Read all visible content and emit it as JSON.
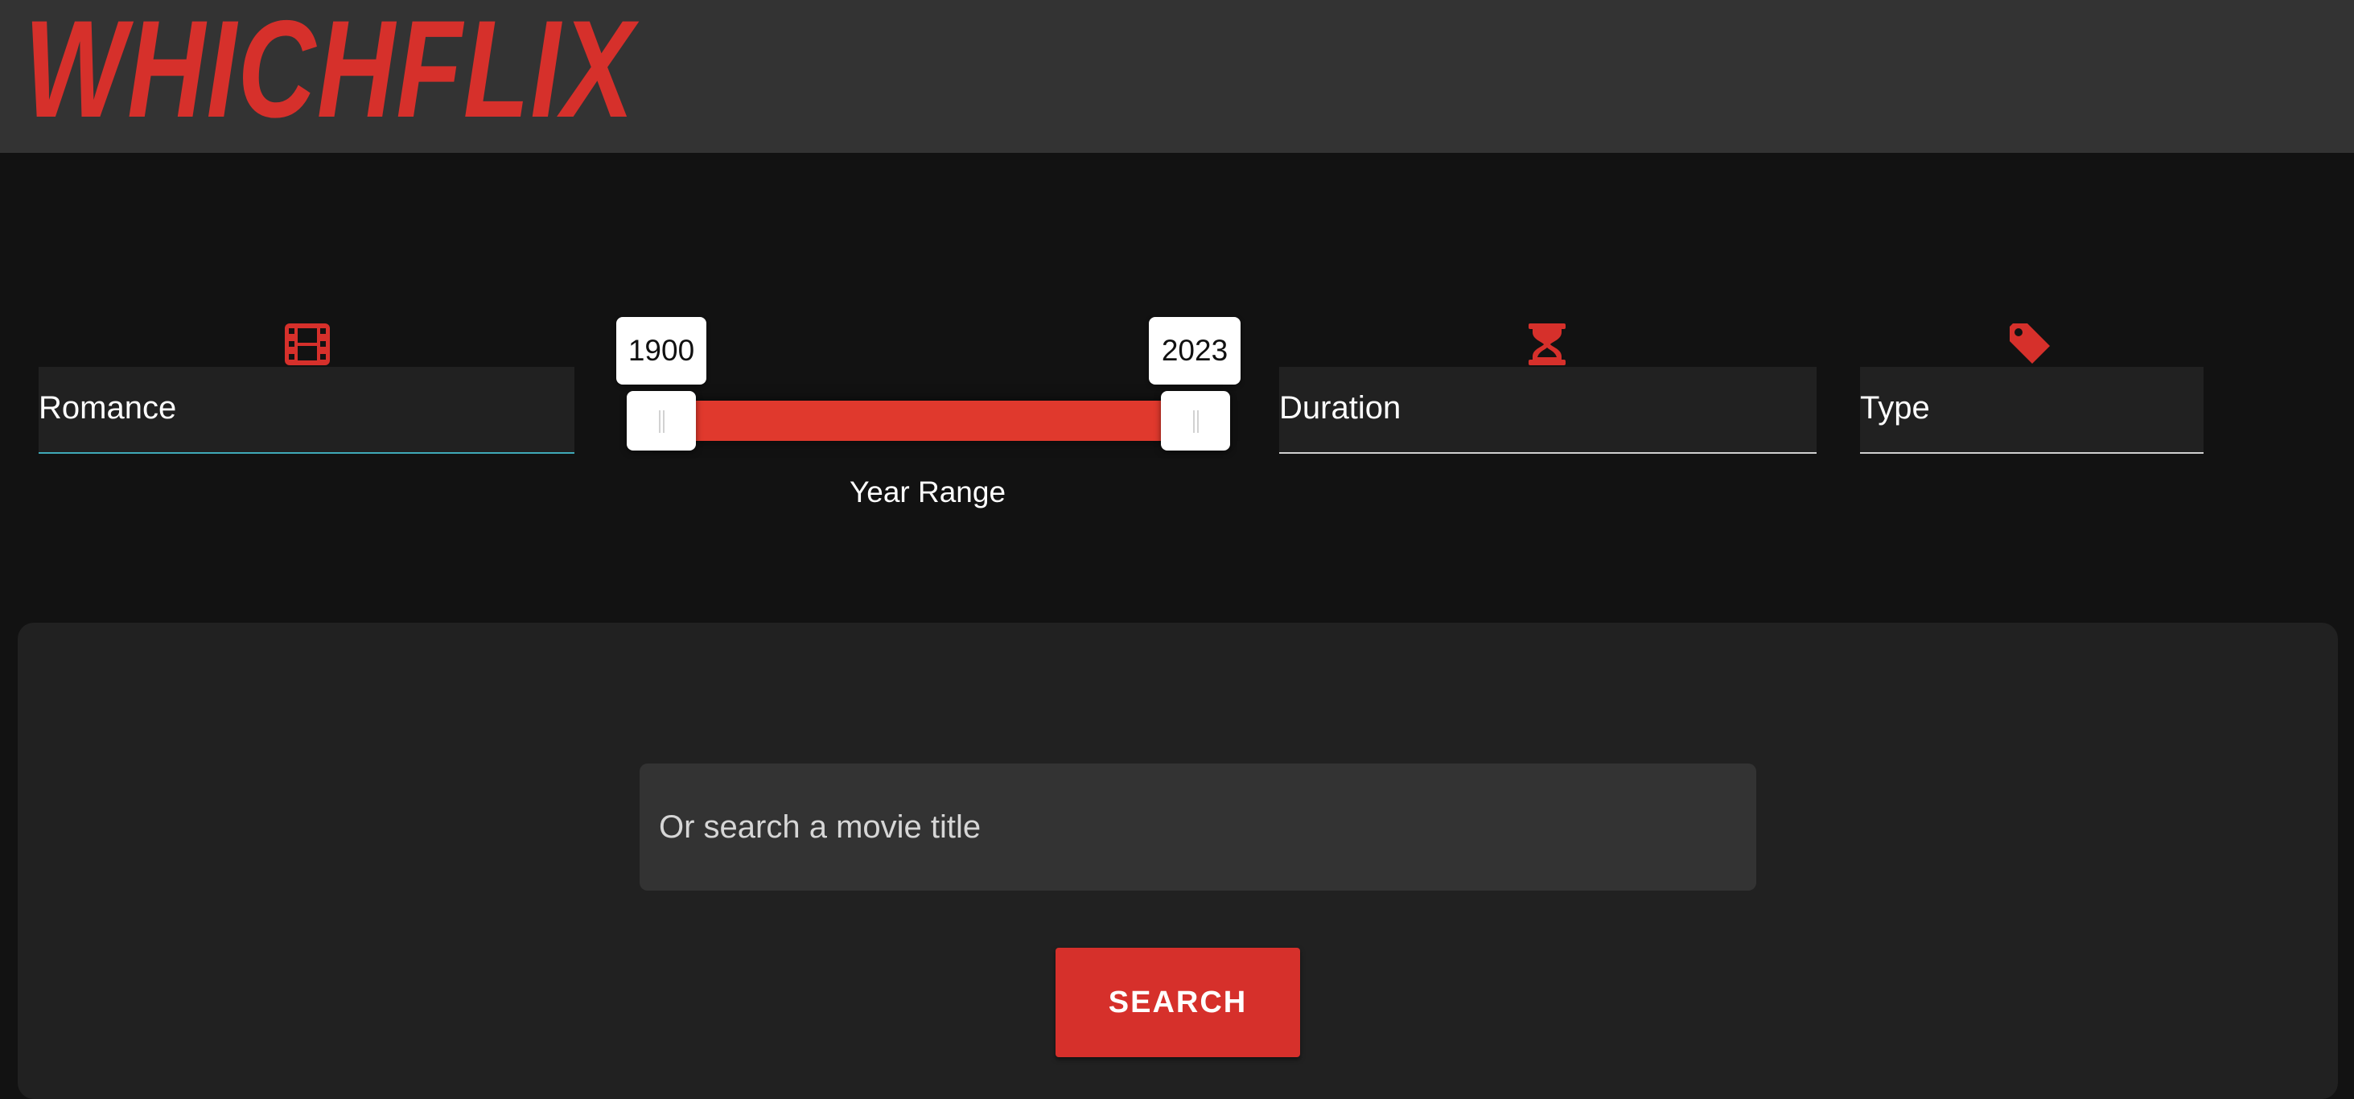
{
  "header": {
    "logo_text": "WHICHFLIX"
  },
  "filters": {
    "genre": {
      "value": "Romance",
      "icon": "film-icon"
    },
    "year_range": {
      "min": "1900",
      "max": "2023",
      "label": "Year Range"
    },
    "duration": {
      "value": "Duration",
      "icon": "hourglass-icon"
    },
    "type": {
      "value": "Type",
      "icon": "tag-icon"
    }
  },
  "search": {
    "placeholder": "Or search a movie title",
    "button_label": "SEARCH"
  },
  "colors": {
    "accent": "#d6302b",
    "header_bg": "#333333",
    "page_bg": "#121212",
    "panel_bg": "#212121"
  }
}
